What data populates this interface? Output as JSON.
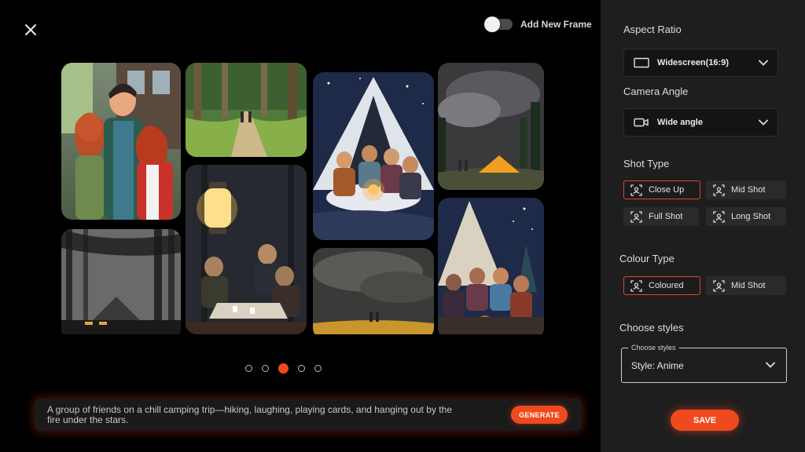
{
  "header": {
    "close_icon": "close-icon",
    "add_frame_label": "Add New Frame",
    "add_frame_enabled": false
  },
  "gallery": {
    "frames": [
      {
        "name": "frame-friends-portrait",
        "scene": "three friends smiling by a cabin"
      },
      {
        "name": "frame-forest-trail",
        "scene": "two hikers on a forest trail"
      },
      {
        "name": "frame-tent-cards",
        "scene": "friends playing cards in a tent at night"
      },
      {
        "name": "frame-storm-tent",
        "scene": "tent under stormy sky with hikers"
      },
      {
        "name": "frame-lantern-cards",
        "scene": "lantern over friends playing cards"
      },
      {
        "name": "frame-misty-forest",
        "scene": "misty dark forest with tent"
      },
      {
        "name": "frame-cloudy-field",
        "scene": "dark clouds over golden field"
      },
      {
        "name": "frame-tent-group",
        "scene": "group gathered inside tent under stars"
      }
    ],
    "pagination": {
      "count": 5,
      "active_index": 2
    }
  },
  "prompt": {
    "text": "A group of friends on a chill camping trip—hiking, laughing, playing cards, and hanging out by the fire under the stars.",
    "generate_label": "GENERATE"
  },
  "sidebar": {
    "aspect_ratio": {
      "label": "Aspect Ratio",
      "value": "Widescreen(16:9)",
      "icon": "widescreen-icon"
    },
    "camera_angle": {
      "label": "Camera Angle",
      "value": "Wide angle",
      "icon": "camera-icon"
    },
    "shot_type": {
      "label": "Shot Type",
      "options": [
        {
          "label": "Close Up",
          "selected": true
        },
        {
          "label": "Mid Shot",
          "selected": false
        },
        {
          "label": "Full Shot",
          "selected": false
        },
        {
          "label": "Long Shot",
          "selected": false
        }
      ]
    },
    "colour_type": {
      "label": "Colour Type",
      "options": [
        {
          "label": "Coloured",
          "selected": true
        },
        {
          "label": "Mid Shot",
          "selected": false
        }
      ]
    },
    "styles": {
      "label": "Choose styles",
      "field_legend": "Choose styles",
      "value": "Style: Anime"
    },
    "save_label": "SAVE"
  },
  "colors": {
    "accent": "#ef4a1e",
    "sidebar_bg": "#1e1e1e",
    "main_bg": "#000000"
  }
}
